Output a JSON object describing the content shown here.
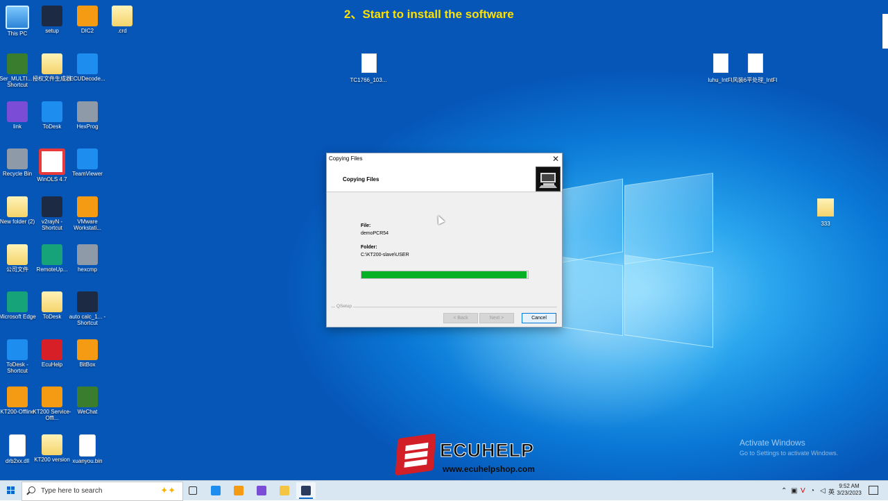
{
  "header": {
    "step_title": "2、Start to install the software"
  },
  "desktop_icons": [
    {
      "label": "This PC",
      "icon": "pc-icon"
    },
    {
      "label": "setup",
      "icon": "setup-icon"
    },
    {
      "label": "DIC2",
      "icon": "engine-icon"
    },
    {
      "label": ".crd",
      "icon": "folder-icon"
    },
    {
      "label": "Ser_MULTI... - Shortcut",
      "icon": "board-icon"
    },
    {
      "label": "授权文件生成器",
      "icon": "folder-icon"
    },
    {
      "label": "ECUDecode...",
      "icon": "globe-icon"
    },
    {
      "label": "link",
      "icon": "link-app-icon"
    },
    {
      "label": "ToDesk",
      "icon": "todesk-icon"
    },
    {
      "label": "HexProg",
      "icon": "hexprog-icon"
    },
    {
      "label": "Recycle Bin",
      "icon": "recycle-bin-icon"
    },
    {
      "label": "WinOLS 4.7",
      "icon": "winols-icon"
    },
    {
      "label": "TeamViewer",
      "icon": "teamviewer-icon"
    },
    {
      "label": "New folder (2)",
      "icon": "folder-icon"
    },
    {
      "label": "v2rayN - Shortcut",
      "icon": "v2rayn-icon"
    },
    {
      "label": "VMware Workstati...",
      "icon": "vmware-icon"
    },
    {
      "label": "公司文件",
      "icon": "folder-icon"
    },
    {
      "label": "RemoteUp...",
      "icon": "remote-icon"
    },
    {
      "label": "hexcmp",
      "icon": "hexcmp-icon"
    },
    {
      "label": "Microsoft Edge",
      "icon": "edge-icon"
    },
    {
      "label": "ToDesk",
      "icon": "folder-icon"
    },
    {
      "label": "auto calc_1... - Shortcut",
      "icon": "chip-icon"
    },
    {
      "label": "ToDesk - Shortcut",
      "icon": "todesk-icon"
    },
    {
      "label": "EcuHelp",
      "icon": "ecuhelp-icon"
    },
    {
      "label": "BitBox",
      "icon": "bitbox-icon"
    },
    {
      "label": "KT200-Offline",
      "icon": "kt200-icon"
    },
    {
      "label": "KT200 Service-Offl...",
      "icon": "kt200-icon"
    },
    {
      "label": "WeChat",
      "icon": "wechat-icon"
    },
    {
      "label": "drb2xx.dll",
      "icon": "dll-icon"
    },
    {
      "label": "KT200 version",
      "icon": "folder-icon"
    },
    {
      "label": "xuanyou.bin",
      "icon": "file-icon"
    }
  ],
  "scattered_icons": [
    {
      "label": "TC1766_103...",
      "icon": "file-icon"
    },
    {
      "label": "luhu_IntFl",
      "icon": "file-icon"
    },
    {
      "label": "风装6平处理_IntFl",
      "icon": "file-icon"
    },
    {
      "label": "333",
      "icon": "folder-icon"
    }
  ],
  "dialog": {
    "title": "Copying Files",
    "header": "Copying Files",
    "file_label": "File:",
    "file_value": "demoPCR54",
    "folder_label": "Folder:",
    "folder_value": "C:\\KT200-slave\\USER",
    "progress": 0.99,
    "footer_label": "QSetup",
    "back_button": "< Back",
    "next_button": "Next >",
    "cancel_button": "Cancel",
    "accent": "#06b025"
  },
  "watermark": {
    "title": "Activate Windows",
    "subtitle": "Go to Settings to activate Windows."
  },
  "brand": {
    "name": "ECUHELP",
    "url": "www.ecuhelpshop.com",
    "color": "#d21e26"
  },
  "taskbar": {
    "search_placeholder": "Type here to search",
    "apps": [
      "task-view-icon",
      "todesk-icon",
      "diag-app-icon",
      "link-app-icon",
      "file-explorer-icon",
      "setup-icon"
    ],
    "time": "9:52 AM",
    "date": "3/23/2023"
  }
}
